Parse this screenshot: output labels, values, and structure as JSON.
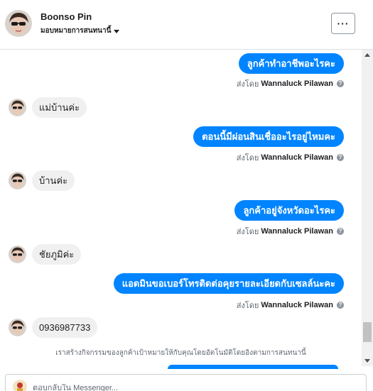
{
  "header": {
    "name": "Boonso Pin",
    "assign_label": "มอบหมายการสนทนานี้",
    "more_label": "···"
  },
  "messages": [
    {
      "dir": "out",
      "text": "ลูกค้าทำอาชีพอะไรคะ"
    },
    {
      "dir": "sentby",
      "prefix": "ส่งโดย",
      "agent": "Wannaluck Pilawan",
      "info": "?"
    },
    {
      "dir": "in",
      "text": "แม่บ้านค่ะ"
    },
    {
      "dir": "out",
      "text": "ตอนนี้มีผ่อนสินเชื่ออะไรอยู่ไหมคะ"
    },
    {
      "dir": "sentby",
      "prefix": "ส่งโดย",
      "agent": "Wannaluck Pilawan",
      "info": "?"
    },
    {
      "dir": "in",
      "text": "บ้านค่ะ"
    },
    {
      "dir": "out",
      "text": "ลูกค้าอยู่จังหวัดอะไรคะ"
    },
    {
      "dir": "sentby",
      "prefix": "ส่งโดย",
      "agent": "Wannaluck Pilawan",
      "info": "?"
    },
    {
      "dir": "in",
      "text": "ชัยภูมิค่ะ"
    },
    {
      "dir": "out",
      "text": "แอดมินขอเบอร์โทรติดต่อคุยรายละเอียดกับเซลล์นะคะ"
    },
    {
      "dir": "sentby",
      "prefix": "ส่งโดย",
      "agent": "Wannaluck Pilawan",
      "info": "?"
    },
    {
      "dir": "in",
      "text": "0936987733"
    }
  ],
  "notice": "เราสร้างกิจกรรมของลูกค้าเป้าหมายให้กับคุณโดยอัตโนมัติโดยอิงตามการสนทนานี้",
  "composer": {
    "placeholder": "ตอบกลับใน Messenger..."
  },
  "colors": {
    "outgoing_bubble": "#0084ff",
    "incoming_bubble": "#f1f0f0"
  }
}
